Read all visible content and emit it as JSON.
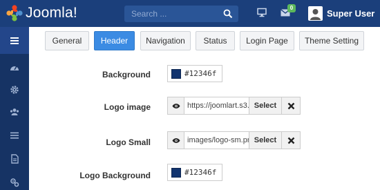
{
  "app": {
    "logo_text": "Joomla!"
  },
  "header": {
    "search_placeholder": "Search ...",
    "mail_count": "0",
    "user_name": "Super User"
  },
  "sidebar": {
    "items": [
      {
        "icon": "menu-icon"
      },
      {
        "icon": "dashboard-icon"
      },
      {
        "icon": "gear-icon"
      },
      {
        "icon": "users-icon"
      },
      {
        "icon": "list-icon"
      },
      {
        "icon": "document-icon"
      },
      {
        "icon": "puzzle-icon"
      }
    ]
  },
  "tabs": [
    {
      "label": "General",
      "active": false
    },
    {
      "label": "Header",
      "active": true
    },
    {
      "label": "Navigation",
      "active": false
    },
    {
      "label": "Status",
      "active": false
    },
    {
      "label": "Login Page",
      "active": false
    },
    {
      "label": "Theme Setting",
      "active": false
    }
  ],
  "form": {
    "background": {
      "label": "Background",
      "value": "#12346f"
    },
    "logo_image": {
      "label": "Logo image",
      "value": "https://joomlart.s3.",
      "select_label": "Select"
    },
    "logo_small": {
      "label": "Logo Small",
      "value": "images/logo-sm.pn",
      "select_label": "Select"
    },
    "logo_background": {
      "label": "Logo Background",
      "value": "#12346f"
    }
  },
  "colors": {
    "topbar": "#1b3f7b",
    "sidebar": "#163364",
    "active_tab": "#3b8be3",
    "swatch": "#12346f"
  }
}
